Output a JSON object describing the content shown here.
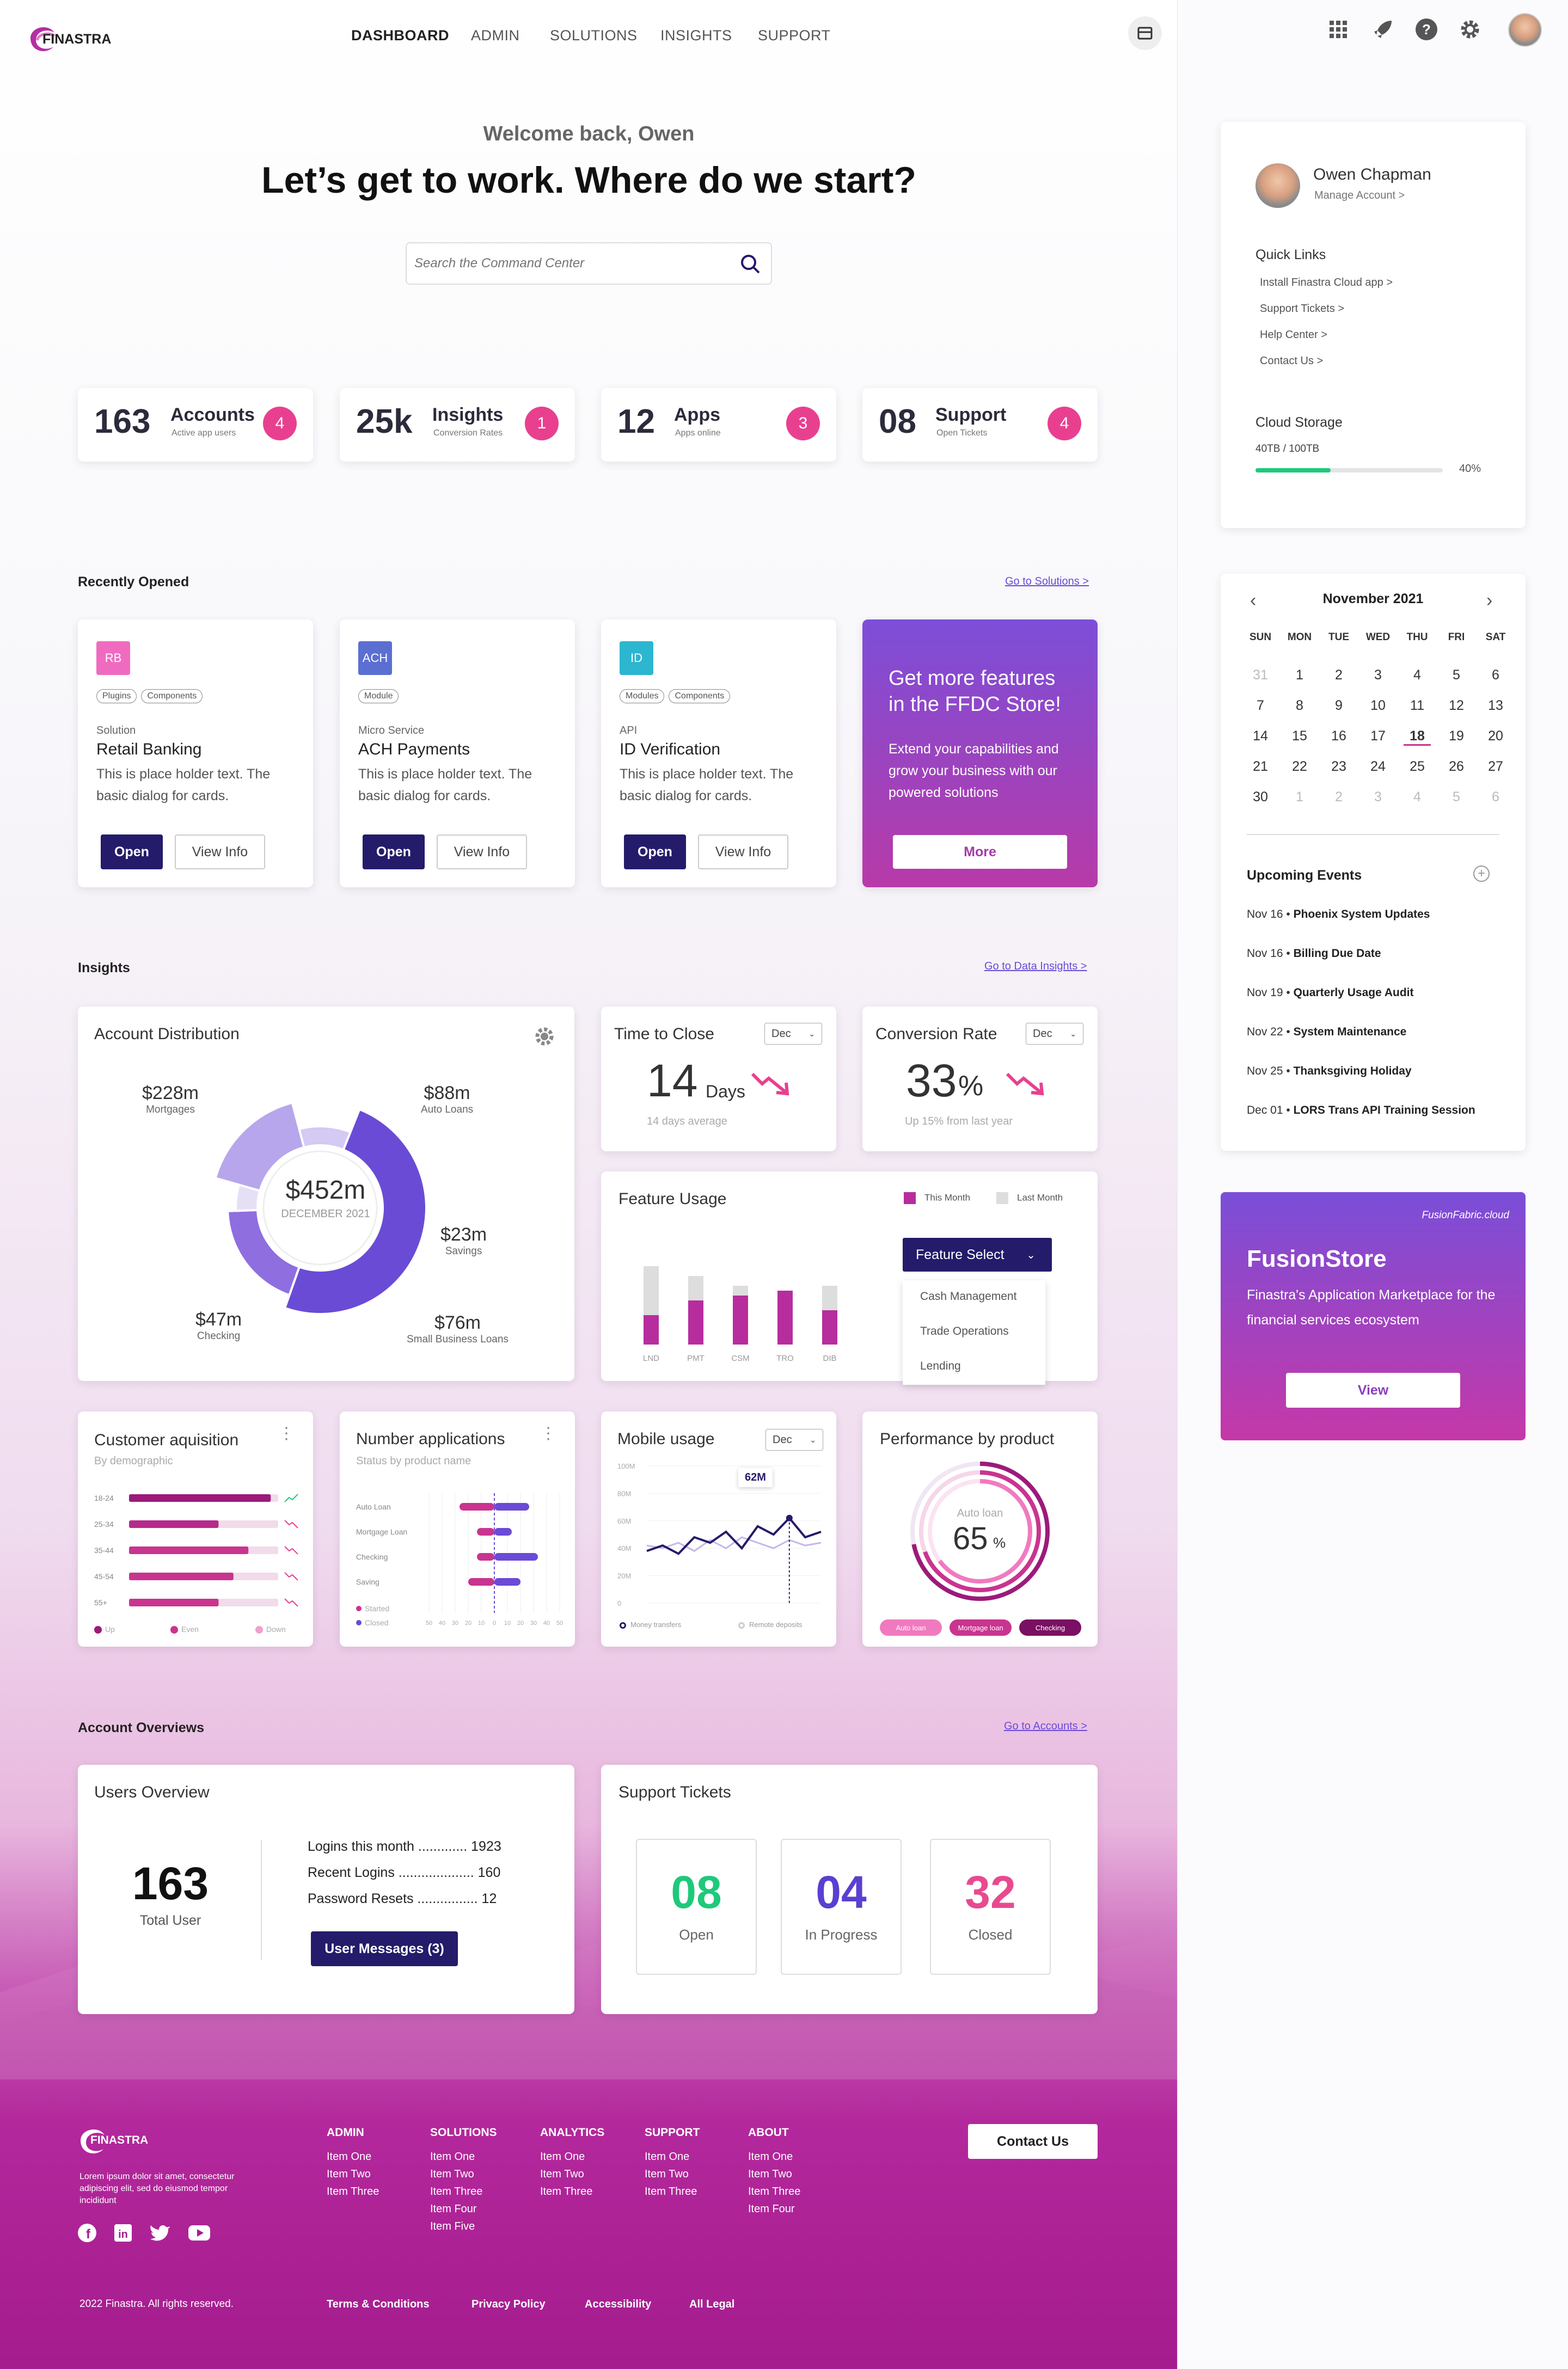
{
  "brand": {
    "logo": "FINASTRA"
  },
  "nav": [
    "DASHBOARD",
    "ADMIN",
    "SOLUTIONS",
    "INSIGHTS",
    "SUPPORT"
  ],
  "hero": {
    "welcome": "Welcome back, Owen",
    "headline": "Let’s get to work. Where do we start?",
    "search_placeholder": "Search the Command Center"
  },
  "stats": [
    {
      "num": "163",
      "label": "Accounts",
      "sub": "Active app users",
      "badge": "4"
    },
    {
      "num": "25k",
      "label": "Insights",
      "sub": "Conversion Rates",
      "badge": "1"
    },
    {
      "num": "12",
      "label": "Apps",
      "sub": "Apps online",
      "badge": "3"
    },
    {
      "num": "08",
      "label": "Support",
      "sub": "Open Tickets",
      "badge": "4"
    }
  ],
  "recent": {
    "title": "Recently Opened",
    "link": "Go to Solutions >",
    "cards": [
      {
        "tag": "RB",
        "tag_color": "#f06bc0",
        "pills": [
          "Plugins",
          "Components"
        ],
        "kind": "Solution",
        "name": "Retail Banking",
        "desc": "This is place holder text. The basic dialog for cards.",
        "open": "Open",
        "info": "View Info"
      },
      {
        "tag": "ACH",
        "tag_color": "#5a6fd1",
        "pills": [
          "Module"
        ],
        "kind": "Micro Service",
        "name": "ACH Payments",
        "desc": "This is place holder text. The basic dialog for cards.",
        "open": "Open",
        "info": "View Info"
      },
      {
        "tag": "ID",
        "tag_color": "#2cb6d0",
        "pills": [
          "Modules",
          "Components"
        ],
        "kind": "API",
        "name": "ID Verification",
        "desc": "This is place holder text. The basic dialog for cards.",
        "open": "Open",
        "info": "View Info"
      }
    ],
    "promo": {
      "title": "Get more features in the FFDC Store!",
      "text": "Extend your capabilities and grow your business with our powered solutions",
      "button": "More"
    }
  },
  "insights": {
    "title": "Insights",
    "link": "Go to Data Insights >",
    "account_distribution": {
      "title": "Account Distribution",
      "center": "$452m",
      "center_sub": "DECEMBER 2021",
      "labels": [
        {
          "v": "$228m",
          "s": "Mortgages"
        },
        {
          "v": "$88m",
          "s": "Auto Loans"
        },
        {
          "v": "$23m",
          "s": "Savings"
        },
        {
          "v": "$76m",
          "s": "Small Business Loans"
        },
        {
          "v": "$47m",
          "s": "Checking"
        }
      ]
    },
    "time_to_close": {
      "title": "Time to Close",
      "select": "Dec",
      "value": "14",
      "unit": "Days",
      "sub": "14 days average"
    },
    "conversion": {
      "title": "Conversion Rate",
      "select": "Dec",
      "value": "33",
      "unit": "%",
      "sub": "Up 15% from last year"
    },
    "feature_usage": {
      "title": "Feature Usage",
      "legend": [
        "This Month",
        "Last Month"
      ],
      "select": "Feature Select",
      "options": [
        "Cash Management",
        "Trade Operations",
        "Lending"
      ]
    },
    "customer": {
      "title": "Customer aquisition",
      "sub": "By demographic",
      "legend": [
        "Up",
        "Even",
        "Down"
      ]
    },
    "applications": {
      "title": "Number applications",
      "sub": "Status by product name",
      "legend": [
        "Started",
        "Closed"
      ]
    },
    "mobile": {
      "title": "Mobile usage",
      "select": "Dec",
      "tooltip": "62M",
      "legend": [
        "Money transfers",
        "Remote deposits"
      ]
    },
    "performance": {
      "title": "Performance by product",
      "inner_label": "Auto loan",
      "value": "65",
      "unit": "%",
      "tags": [
        "Auto loan",
        "Mortgage loan",
        "Checking"
      ]
    }
  },
  "chart_data": [
    {
      "type": "pie",
      "title": "Account Distribution",
      "categories": [
        "Mortgages",
        "Auto Loans",
        "Savings",
        "Small Business Loans",
        "Checking"
      ],
      "values": [
        228,
        88,
        23,
        76,
        47
      ]
    },
    {
      "type": "bar",
      "title": "Feature Usage",
      "categories": [
        "LND",
        "PMT",
        "CSM",
        "TRO",
        "DIB"
      ],
      "series": [
        {
          "name": "This Month",
          "values": [
            30,
            45,
            50,
            55,
            35
          ]
        },
        {
          "name": "Last Month",
          "values": [
            50,
            25,
            10,
            0,
            25
          ]
        }
      ],
      "ylim": [
        0,
        100
      ]
    },
    {
      "type": "bar",
      "title": "Customer aquisition",
      "categories": [
        "18-24",
        "25-34",
        "35-44",
        "45-54",
        "55+"
      ],
      "values": [
        95,
        60,
        80,
        70,
        60
      ]
    },
    {
      "type": "bar",
      "title": "Number applications",
      "categories": [
        "Auto Loan",
        "Mortgage Loan",
        "Checking",
        "Saving"
      ],
      "series": [
        {
          "name": "Started",
          "values": [
            -20,
            -10,
            -10,
            -15
          ]
        },
        {
          "name": "Closed",
          "values": [
            20,
            10,
            25,
            15
          ]
        }
      ],
      "xlim": [
        -50,
        50
      ]
    },
    {
      "type": "line",
      "title": "Mobile usage",
      "y_ticks": [
        "100M",
        "80M",
        "60M",
        "40M",
        "20M",
        "0"
      ],
      "series": [
        {
          "name": "Money transfers",
          "values": [
            38,
            42,
            36,
            48,
            44,
            52,
            40,
            56,
            50,
            62,
            48,
            52
          ]
        },
        {
          "name": "Remote deposits",
          "values": [
            42,
            40,
            44,
            38,
            46,
            40,
            48,
            44,
            40,
            46,
            42,
            44
          ]
        }
      ],
      "ylim": [
        0,
        100
      ]
    }
  ],
  "overviews": {
    "title": "Account Overviews",
    "link": "Go to Accounts >",
    "users": {
      "title": "Users Overview",
      "total": "163",
      "total_label": "Total User",
      "rows": [
        "Logins this month ............. 1923",
        "Recent Logins .................... 160",
        "Password Resets ................ 12"
      ],
      "button": "User Messages (3)"
    },
    "tickets": {
      "title": "Support Tickets",
      "items": [
        {
          "n": "08",
          "t": "Open",
          "c": "#1fc97a"
        },
        {
          "n": "04",
          "t": "In Progress",
          "c": "#5b3fd1"
        },
        {
          "n": "32",
          "t": "Closed",
          "c": "#e84a8f"
        }
      ]
    }
  },
  "footer": {
    "tagline": "Lorem ipsum dolor sit amet, consectetur adipiscing elit, sed do eiusmod tempor incididunt",
    "cols": [
      {
        "h": "ADMIN",
        "items": [
          "Item One",
          "Item Two",
          "Item Three"
        ]
      },
      {
        "h": "SOLUTIONS",
        "items": [
          "Item One",
          "Item Two",
          "Item Three",
          "Item Four",
          "Item Five"
        ]
      },
      {
        "h": "ANALYTICS",
        "items": [
          "Item One",
          "Item Two",
          "Item Three"
        ]
      },
      {
        "h": "SUPPORT",
        "items": [
          "Item One",
          "Item Two",
          "Item Three"
        ]
      },
      {
        "h": "ABOUT",
        "items": [
          "Item One",
          "Item Two",
          "Item Three",
          "Item Four"
        ]
      }
    ],
    "contact": "Contact Us",
    "copyright": "2022 Finastra. All rights reserved.",
    "legal": [
      "Terms & Conditions",
      "Privacy Policy",
      "Accessibility",
      "All Legal"
    ]
  },
  "side": {
    "user": "Owen Chapman",
    "manage": "Manage Account >",
    "quick_title": "Quick Links",
    "quick": [
      "Install Finastra Cloud app >",
      "Support Tickets >",
      "Help Center >",
      "Contact Us >"
    ],
    "storage_title": "Cloud Storage",
    "storage": "40TB / 100TB",
    "storage_pct": "40%",
    "storage_fraction": 0.4,
    "calendar": {
      "month": "November 2021",
      "days": [
        "SUN",
        "MON",
        "TUE",
        "WED",
        "THU",
        "FRI",
        "SAT"
      ],
      "weeks": [
        [
          "31",
          "1",
          "2",
          "3",
          "4",
          "5",
          "6"
        ],
        [
          "7",
          "8",
          "9",
          "10",
          "11",
          "12",
          "13"
        ],
        [
          "14",
          "15",
          "16",
          "17",
          "18",
          "19",
          "20"
        ],
        [
          "21",
          "22",
          "23",
          "24",
          "25",
          "26",
          "27"
        ],
        [
          "30",
          "1",
          "2",
          "3",
          "4",
          "5",
          "6"
        ]
      ]
    },
    "events_title": "Upcoming Events",
    "events": [
      {
        "d": "Nov 16",
        "t": "Phoenix System Updates"
      },
      {
        "d": "Nov 16",
        "t": "Billing Due Date"
      },
      {
        "d": "Nov 19",
        "t": "Quarterly Usage Audit"
      },
      {
        "d": "Nov 22",
        "t": "System Maintenance"
      },
      {
        "d": "Nov 25",
        "t": "Thanksgiving Holiday"
      },
      {
        "d": "Dec 01",
        "t": "LORS Trans API Training Session"
      }
    ],
    "store": {
      "brand": "FusionFabric.cloud",
      "title": "FusionStore",
      "text": "Finastra's Application Marketplace for the financial services ecosystem",
      "button": "View"
    }
  },
  "colors": {
    "primary": "#241b6a",
    "accent": "#e8408f",
    "purple": "#6a4bd6"
  }
}
